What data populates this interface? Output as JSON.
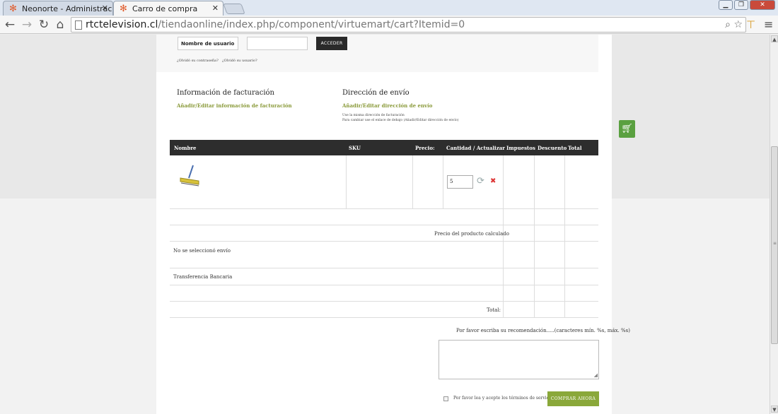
{
  "browser": {
    "tabs": [
      {
        "title": "Neonorte - Administració",
        "active": false
      },
      {
        "title": "Carro de compra",
        "active": true
      }
    ],
    "url_host": "rtctelevision.cl",
    "url_path": "/tiendaonline/index.php/component/virtuemart/cart?Itemid=0"
  },
  "login": {
    "username_placeholder": "Nombre de usuario",
    "submit_label": "ACCEDER",
    "forgot_password": "¿Olvidó su contraseña?",
    "forgot_username": "¿Olvidó su usuario?"
  },
  "billing": {
    "title": "Información de facturación",
    "edit_link": "Añadir/Editar información de facturación"
  },
  "shipping": {
    "title": "Dirección de envío",
    "edit_link": "Añadir/Editar dirección de envío",
    "note_line1": "Use la misma dirección de facturación",
    "note_line2": "Para cambiar use el enlace de debajo (Añadir/Editar dirección de envío)"
  },
  "cart": {
    "headers": {
      "name": "Nombre",
      "sku": "SKU",
      "price": "Precio:",
      "quantity": "Cantidad / Actualizar",
      "taxes": "Impuestos",
      "discount": "Descuento",
      "total": "Total"
    },
    "item": {
      "quantity": "5"
    },
    "product_price_label": "Precio del producto calculado",
    "no_shipping": "No se seleccionó envío",
    "payment_method": "Transferencia Bancaria",
    "total_label": "Total:"
  },
  "comment": {
    "label": "Por favor escriba su recomendación.....(caracteres mín. %s, máx. %s)"
  },
  "checkout": {
    "tos_label": "Por favor lea y acepte los términos de servicio.",
    "buy_button": "COMPRAR AHORA"
  },
  "colors": {
    "accent_green": "#8aa83a",
    "table_header": "#2d2d2d"
  }
}
